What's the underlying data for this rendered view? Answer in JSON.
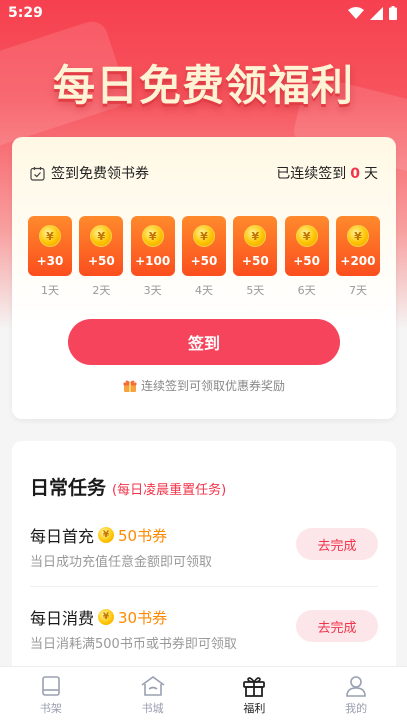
{
  "status_bar": {
    "time": "5:29"
  },
  "hero": {
    "title": "每日免费领福利"
  },
  "signin": {
    "title": "签到免费领书券",
    "streak_prefix": "已连续签到",
    "streak_count": "0",
    "streak_suffix": "天",
    "coin_symbol": "¥",
    "days": [
      {
        "amount": "+30",
        "label": "1天"
      },
      {
        "amount": "+50",
        "label": "2天"
      },
      {
        "amount": "+100",
        "label": "3天"
      },
      {
        "amount": "+50",
        "label": "4天"
      },
      {
        "amount": "+50",
        "label": "5天"
      },
      {
        "amount": "+50",
        "label": "6天"
      },
      {
        "amount": "+200",
        "label": "7天"
      }
    ],
    "button_label": "签到",
    "tip": "连续签到可领取优惠券奖励"
  },
  "tasks": {
    "title": "日常任务",
    "subtitle": "(每日凌晨重置任务)",
    "items": [
      {
        "name": "每日首充",
        "reward": "50书券",
        "desc": "当日成功充值任意金额即可领取",
        "button": "去完成"
      },
      {
        "name": "每日消费",
        "reward": "30书券",
        "desc": "当日消耗满500书币或书券即可领取",
        "button": "去完成"
      }
    ]
  },
  "tabbar": {
    "items": [
      {
        "label": "书架",
        "icon": "bookshelf-icon",
        "active": false
      },
      {
        "label": "书城",
        "icon": "bookstore-icon",
        "active": false
      },
      {
        "label": "福利",
        "icon": "gift-icon",
        "active": true
      },
      {
        "label": "我的",
        "icon": "profile-icon",
        "active": false
      }
    ]
  },
  "colors": {
    "accent": "#f5445b",
    "reward": "#ff8a00",
    "tile": "#fb4e1e"
  }
}
